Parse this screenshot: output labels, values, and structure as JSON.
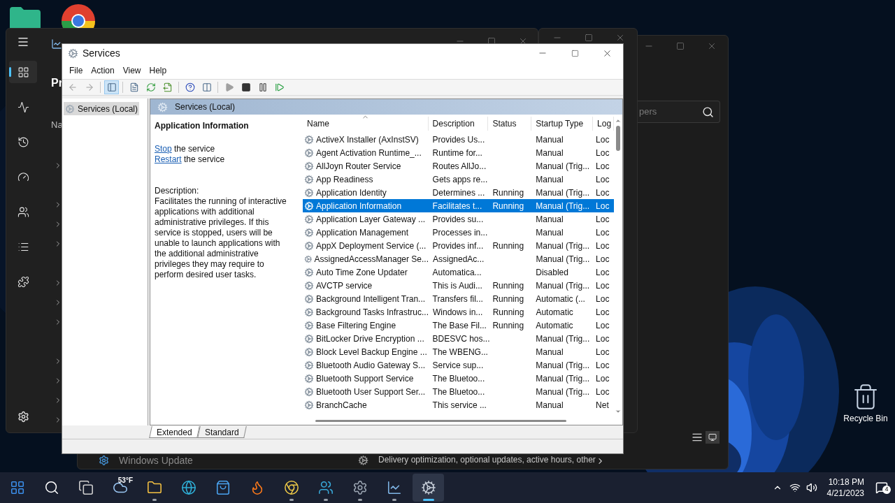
{
  "desktop": {
    "icons": [
      {
        "kind": "folder"
      },
      {
        "kind": "chrome"
      }
    ],
    "recycle_bin": {
      "label": "Recycle Bin"
    }
  },
  "settings_window": {
    "search": {
      "placeholder": "pers"
    },
    "rows": [
      {
        "label": "Windows Update"
      },
      {
        "label": "Delivery optimization, optional updates, active hours, other"
      }
    ]
  },
  "task_manager": {
    "sidebar": [
      {
        "kind": "processes",
        "selected": true
      },
      {
        "kind": "performance",
        "selected": false
      },
      {
        "kind": "history",
        "selected": false
      },
      {
        "kind": "startup",
        "selected": false
      },
      {
        "kind": "users",
        "selected": false
      },
      {
        "kind": "details",
        "selected": false
      },
      {
        "kind": "services",
        "selected": false
      }
    ],
    "heading": "Pr",
    "column": "Na",
    "rows": [
      {
        "expandable": true
      },
      {
        "expandable": false
      },
      {
        "expandable": true
      },
      {
        "expandable": true
      },
      {
        "expandable": true
      },
      {
        "expandable": false
      },
      {
        "expandable": true
      },
      {
        "expandable": true
      },
      {
        "expandable": true
      },
      {
        "expandable": false
      },
      {
        "expandable": true
      },
      {
        "expandable": true
      },
      {
        "expandable": true
      },
      {
        "expandable": true
      }
    ]
  },
  "services": {
    "title": "Services",
    "menu": [
      "File",
      "Action",
      "View",
      "Help"
    ],
    "toolbar": [
      {
        "kind": "back",
        "disabled": true
      },
      {
        "kind": "forward",
        "disabled": true
      },
      {
        "kind": "tree",
        "pressed": true
      },
      {
        "kind": "properties",
        "pressed": false
      },
      {
        "kind": "refresh",
        "pressed": false
      },
      {
        "kind": "export",
        "pressed": false
      },
      {
        "kind": "help",
        "pressed": false
      },
      {
        "kind": "console",
        "pressed": false
      },
      {
        "kind": "start",
        "disabled": true
      },
      {
        "kind": "stop",
        "pressed": false
      },
      {
        "kind": "pause",
        "pressed": false
      },
      {
        "kind": "resume",
        "pressed": false
      }
    ],
    "tree": [
      {
        "label": "Services (Local)",
        "selected": true
      }
    ],
    "panel_title": "Services (Local)",
    "detail": {
      "title": "Application Information",
      "actions": [
        {
          "link": "Stop",
          "text": "the service"
        },
        {
          "link": "Restart",
          "text": "the service"
        }
      ],
      "description_label": "Description:",
      "description": "Facilitates the running of interactive applications with additional administrative privileges.  If this service is stopped, users will be unable to launch applications with the additional administrative privileges they may require to perform desired user tasks."
    },
    "columns": [
      "Name",
      "Description",
      "Status",
      "Startup Type",
      "Log"
    ],
    "rows": [
      {
        "name": "ActiveX Installer (AxInstSV)",
        "description": "Provides Us...",
        "status": "",
        "startup": "Manual",
        "logon": "Loc",
        "selected": false
      },
      {
        "name": "Agent Activation Runtime_...",
        "description": "Runtime for...",
        "status": "",
        "startup": "Manual",
        "logon": "Loc",
        "selected": false
      },
      {
        "name": "AllJoyn Router Service",
        "description": "Routes AllJo...",
        "status": "",
        "startup": "Manual (Trig...",
        "logon": "Loc",
        "selected": false
      },
      {
        "name": "App Readiness",
        "description": "Gets apps re...",
        "status": "",
        "startup": "Manual",
        "logon": "Loc",
        "selected": false
      },
      {
        "name": "Application Identity",
        "description": "Determines ...",
        "status": "Running",
        "startup": "Manual (Trig...",
        "logon": "Loc",
        "selected": false
      },
      {
        "name": "Application Information",
        "description": "Facilitates t...",
        "status": "Running",
        "startup": "Manual (Trig...",
        "logon": "Loc",
        "selected": true
      },
      {
        "name": "Application Layer Gateway ...",
        "description": "Provides su...",
        "status": "",
        "startup": "Manual",
        "logon": "Loc",
        "selected": false
      },
      {
        "name": "Application Management",
        "description": "Processes in...",
        "status": "",
        "startup": "Manual",
        "logon": "Loc",
        "selected": false
      },
      {
        "name": "AppX Deployment Service (...",
        "description": "Provides inf...",
        "status": "Running",
        "startup": "Manual (Trig...",
        "logon": "Loc",
        "selected": false
      },
      {
        "name": "AssignedAccessManager Se...",
        "description": "AssignedAc...",
        "status": "",
        "startup": "Manual (Trig...",
        "logon": "Loc",
        "selected": false
      },
      {
        "name": "Auto Time Zone Updater",
        "description": "Automatica...",
        "status": "",
        "startup": "Disabled",
        "logon": "Loc",
        "selected": false
      },
      {
        "name": "AVCTP service",
        "description": "This is Audi...",
        "status": "Running",
        "startup": "Manual (Trig...",
        "logon": "Loc",
        "selected": false
      },
      {
        "name": "Background Intelligent Tran...",
        "description": "Transfers fil...",
        "status": "Running",
        "startup": "Automatic (...",
        "logon": "Loc",
        "selected": false
      },
      {
        "name": "Background Tasks Infrastruc...",
        "description": "Windows in...",
        "status": "Running",
        "startup": "Automatic",
        "logon": "Loc",
        "selected": false
      },
      {
        "name": "Base Filtering Engine",
        "description": "The Base Fil...",
        "status": "Running",
        "startup": "Automatic",
        "logon": "Loc",
        "selected": false
      },
      {
        "name": "BitLocker Drive Encryption ...",
        "description": "BDESVC hos...",
        "status": "",
        "startup": "Manual (Trig...",
        "logon": "Loc",
        "selected": false
      },
      {
        "name": "Block Level Backup Engine ...",
        "description": "The WBENG...",
        "status": "",
        "startup": "Manual",
        "logon": "Loc",
        "selected": false
      },
      {
        "name": "Bluetooth Audio Gateway S...",
        "description": "Service sup...",
        "status": "",
        "startup": "Manual (Trig...",
        "logon": "Loc",
        "selected": false
      },
      {
        "name": "Bluetooth Support Service",
        "description": "The Bluetoo...",
        "status": "",
        "startup": "Manual (Trig...",
        "logon": "Loc",
        "selected": false
      },
      {
        "name": "Bluetooth User Support Ser...",
        "description": "The Bluetoo...",
        "status": "",
        "startup": "Manual (Trig...",
        "logon": "Loc",
        "selected": false
      },
      {
        "name": "BranchCache",
        "description": "This service ...",
        "status": "",
        "startup": "Manual",
        "logon": "Net",
        "selected": false
      }
    ],
    "tabs": [
      {
        "label": "Extended",
        "selected": true
      },
      {
        "label": "Standard",
        "selected": false
      }
    ]
  },
  "taskbar": {
    "items": [
      {
        "kind": "start",
        "open": false,
        "selected": false
      },
      {
        "kind": "search",
        "open": false,
        "selected": false
      },
      {
        "kind": "taskview",
        "open": false,
        "selected": false
      },
      {
        "kind": "weather",
        "label": "53°F",
        "open": false,
        "selected": false
      },
      {
        "kind": "explorer",
        "open": true,
        "selected": false
      },
      {
        "kind": "edge",
        "open": false,
        "selected": false
      },
      {
        "kind": "store",
        "open": false,
        "selected": false
      },
      {
        "kind": "firefox",
        "open": false,
        "selected": false
      },
      {
        "kind": "chrome",
        "open": true,
        "selected": false
      },
      {
        "kind": "app",
        "open": true,
        "selected": false
      },
      {
        "kind": "settings",
        "open": true,
        "selected": false
      },
      {
        "kind": "taskmanager",
        "open": true,
        "selected": false
      },
      {
        "kind": "services",
        "open": true,
        "selected": true
      }
    ],
    "time": "10:18 PM",
    "date": "4/21/2023",
    "notifications": "4"
  }
}
